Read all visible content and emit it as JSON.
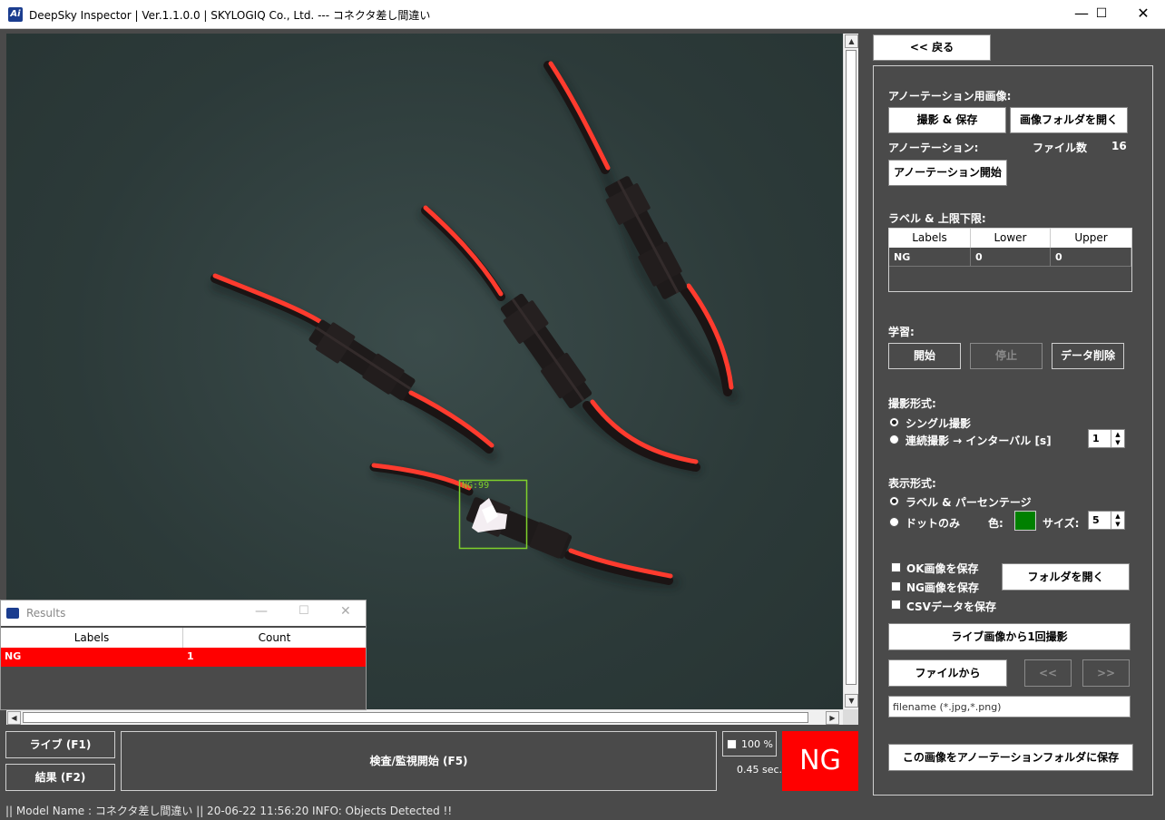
{
  "window": {
    "title": "DeepSky Inspector | Ver.1.1.0.0 | SKYLOGIQ Co., Ltd. --- コネクタ差し間違い",
    "app_icon_text": "Ai",
    "min_glyph": "—",
    "max_glyph": "☐",
    "close_glyph": "✕"
  },
  "viewport": {
    "detection_label": "NG:99",
    "detection_color": "#7fd12b"
  },
  "bottom": {
    "live_button": "ライブ (F1)",
    "result_button": "結果 (F2)",
    "inspect_button": "検査/監視開始 (F5)",
    "zoom_label": "100 %",
    "elapsed": "0.45 sec.",
    "judgement": "NG"
  },
  "right": {
    "back_button": "<< 戻る",
    "annotation_image_label": "アノーテーション用画像:",
    "capture_save_button": "撮影 & 保存",
    "open_image_folder_button": "画像フォルダを開く",
    "annotation_label": "アノーテーション:",
    "file_count_label": "ファイル数",
    "file_count_value": "16",
    "annotation_start_button": "アノーテーション開始",
    "label_limits_label": "ラベル & 上限下限:",
    "table": {
      "headers": [
        "Labels",
        "Lower",
        "Upper"
      ],
      "rows": [
        [
          "NG",
          "0",
          "0"
        ]
      ]
    },
    "learning_label": "学習:",
    "start_button": "開始",
    "stop_button": "停止",
    "delete_data_button": "データ削除",
    "capture_mode_label": "撮影形式:",
    "single_capture": "シングル撮影",
    "continuous_capture": "連続撮影 → インターバル [s]",
    "interval_value": "1",
    "display_mode_label": "表示形式:",
    "label_percentage": "ラベル & パーセンテージ",
    "dot_only": "ドットのみ",
    "color_label": "色:",
    "dot_color": "#008000",
    "size_label": "サイズ:",
    "size_value": "5",
    "save_ok_image": "OK画像を保存",
    "save_ng_image": "NG画像を保存",
    "save_csv": "CSVデータを保存",
    "open_folder_button": "フォルダを開く",
    "capture_once_button": "ライブ画像から1回撮影",
    "from_file_button": "ファイルから",
    "prev_button": "<<",
    "next_button": ">>",
    "filename_placeholder": "filename (*.jpg,*.png)",
    "save_to_annotation_button": "この画像をアノーテーションフォルダに保存"
  },
  "results": {
    "title": "Results",
    "headers": [
      "Labels",
      "Count"
    ],
    "rows": [
      [
        "NG",
        "1"
      ]
    ],
    "row_color": "#ff0000"
  },
  "status": {
    "text": "|| Model Name : コネクタ差し間違い ||    20-06-22 11:56:20   INFO:   Objects Detected !!"
  }
}
